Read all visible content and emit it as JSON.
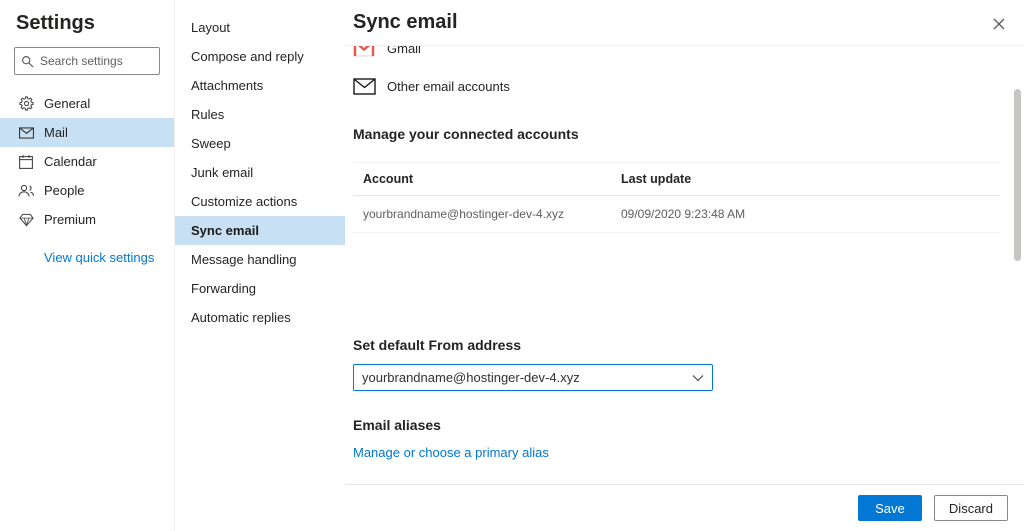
{
  "app": {
    "title": "Settings"
  },
  "sidebar": {
    "search_placeholder": "Search settings",
    "items": [
      {
        "label": "General"
      },
      {
        "label": "Mail"
      },
      {
        "label": "Calendar"
      },
      {
        "label": "People"
      },
      {
        "label": "Premium"
      }
    ],
    "quick_settings_link": "View quick settings"
  },
  "mail_nav": {
    "items": [
      {
        "label": "Layout"
      },
      {
        "label": "Compose and reply"
      },
      {
        "label": "Attachments"
      },
      {
        "label": "Rules"
      },
      {
        "label": "Sweep"
      },
      {
        "label": "Junk email"
      },
      {
        "label": "Customize actions"
      },
      {
        "label": "Sync email"
      },
      {
        "label": "Message handling"
      },
      {
        "label": "Forwarding"
      },
      {
        "label": "Automatic replies"
      }
    ]
  },
  "main": {
    "title": "Sync email",
    "account_options": [
      {
        "label": "Gmail"
      },
      {
        "label": "Other email accounts"
      }
    ],
    "connected_accounts": {
      "heading": "Manage your connected accounts",
      "columns": [
        "Account",
        "Last update"
      ],
      "rows": [
        {
          "account": "yourbrandname@hostinger-dev-4.xyz",
          "last_update": "09/09/2020 9:23:48 AM"
        }
      ]
    },
    "default_from": {
      "heading": "Set default From address",
      "value": "yourbrandname@hostinger-dev-4.xyz"
    },
    "email_aliases": {
      "heading": "Email aliases",
      "link": "Manage or choose a primary alias"
    },
    "footer": {
      "save": "Save",
      "discard": "Discard"
    }
  },
  "colors": {
    "accent": "#0078d4",
    "selected_bg": "#c7e0f4"
  }
}
